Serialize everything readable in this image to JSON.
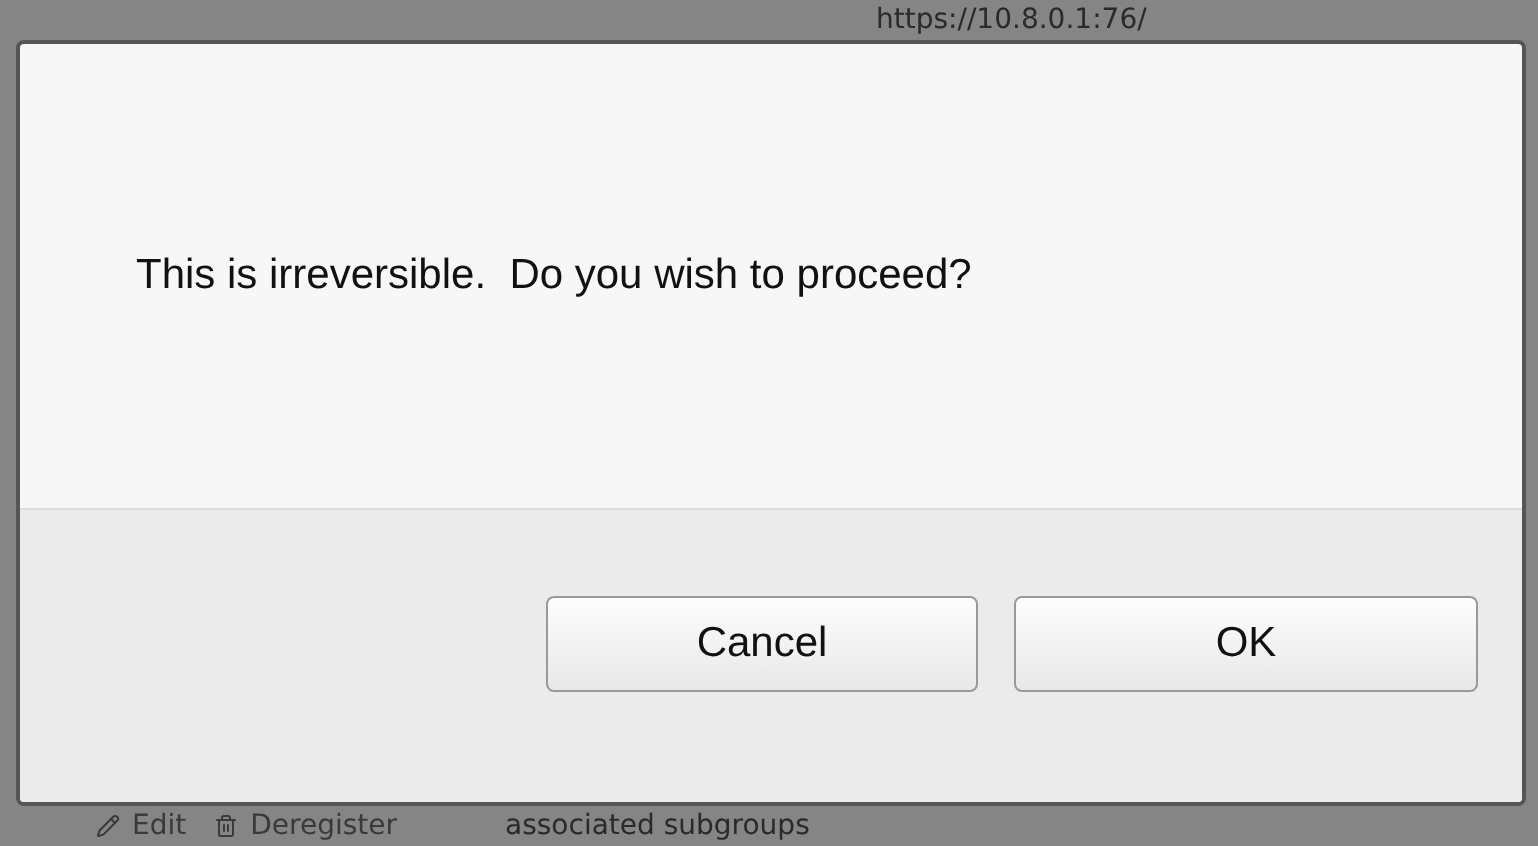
{
  "background": {
    "url": "https://10.8.0.1:76/",
    "actions": [
      "Edit",
      "Deregister"
    ],
    "footer_text": "associated subgroups"
  },
  "dialog": {
    "message": "This is irreversible.  Do you wish to proceed?",
    "buttons": [
      {
        "label": "Cancel",
        "kind": "cancel"
      },
      {
        "label": "OK",
        "kind": "confirm"
      }
    ]
  }
}
